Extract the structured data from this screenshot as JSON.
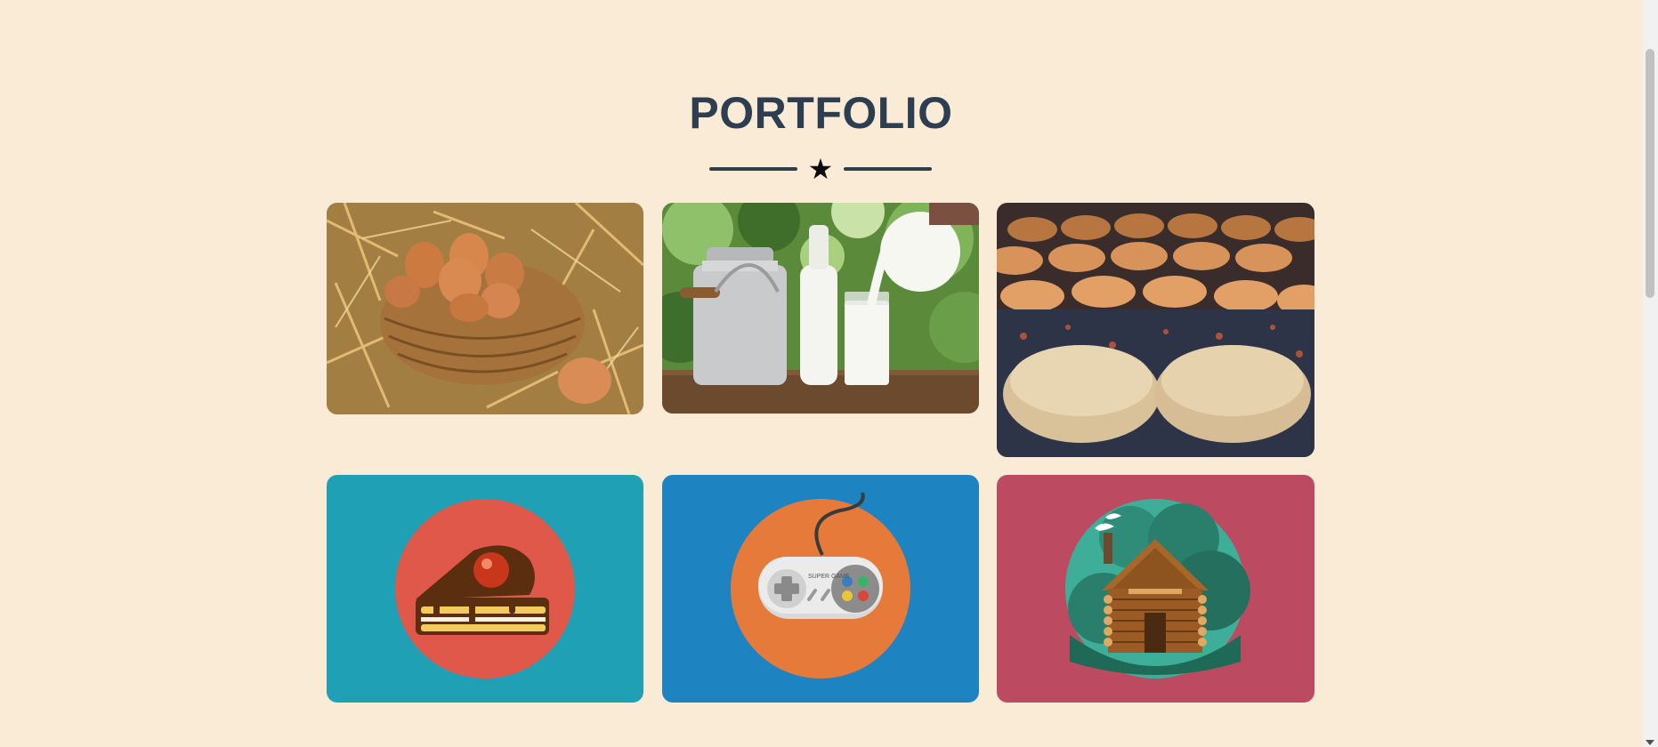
{
  "section": {
    "title": "PORTFOLIO",
    "divider_icon": "★"
  },
  "portfolio": {
    "items": [
      {
        "name": "eggs-in-basket",
        "kind": "photo"
      },
      {
        "name": "milk-jug-and-bottles",
        "kind": "photo"
      },
      {
        "name": "bread-loaves-oven",
        "kind": "photo"
      },
      {
        "name": "cake-slice",
        "kind": "illustration",
        "background": "#1fa0b4",
        "circle": "#e0584a"
      },
      {
        "name": "game-controller",
        "kind": "illustration",
        "background": "#1d83c1",
        "circle": "#e67a3a",
        "controller_text": "SUPER GAME"
      },
      {
        "name": "log-cabin",
        "kind": "illustration",
        "background": "#bc4b62",
        "circle": "#3fae99"
      }
    ]
  },
  "colors": {
    "page_background": "#faebd7",
    "heading": "#2c3e50"
  }
}
